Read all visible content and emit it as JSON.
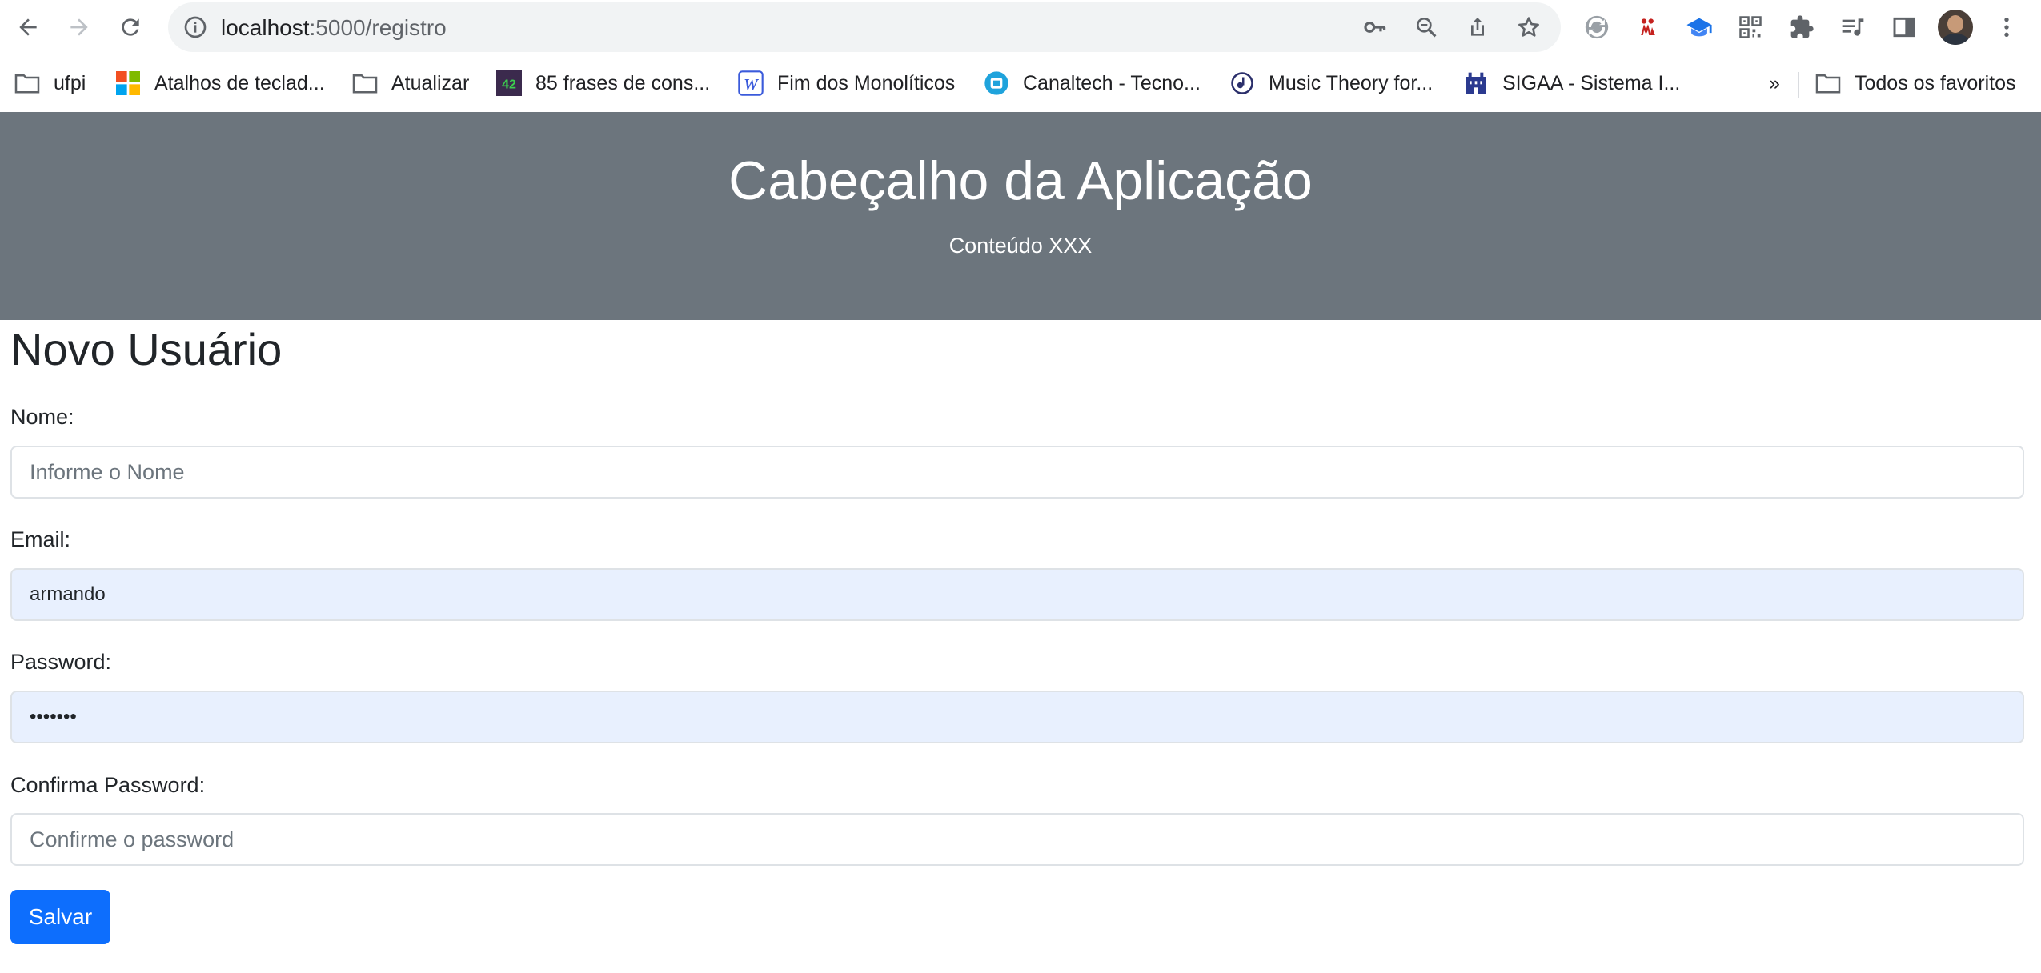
{
  "browser": {
    "url_host": "localhost",
    "url_path": ":5000/registro",
    "bookmarks": [
      {
        "label": "ufpi",
        "icon": "folder-icon"
      },
      {
        "label": "Atalhos de teclad...",
        "icon": "microsoft-logo-icon"
      },
      {
        "label": "Atualizar",
        "icon": "folder-icon"
      },
      {
        "label": "85 frases de cons...",
        "icon": "badge-42-icon",
        "badge": "42"
      },
      {
        "label": "Fim dos Monolíticos",
        "icon": "w-logo-icon",
        "badge": "W"
      },
      {
        "label": "Canaltech - Tecno...",
        "icon": "canaltech-icon"
      },
      {
        "label": "Music Theory for...",
        "icon": "music-theory-icon"
      },
      {
        "label": "SIGAA - Sistema I...",
        "icon": "sigaa-icon"
      }
    ],
    "overflow_label": "»",
    "all_bookmarks_label": "Todos os favoritos"
  },
  "header": {
    "title": "Cabeçalho da Aplicação",
    "subtitle": "Conteúdo XXX",
    "background": "#6c757d"
  },
  "form": {
    "title": "Novo Usuário",
    "nome_label": "Nome:",
    "nome_placeholder": "Informe o Nome",
    "nome_value": "",
    "email_label": "Email:",
    "email_value": "armando",
    "password_label": "Password:",
    "password_value": "•••••••",
    "confirm_label": "Confirma Password:",
    "confirm_placeholder": "Confirme o password",
    "confirm_value": "",
    "submit_label": "Salvar",
    "submit_color": "#0d6efd",
    "autofill_color": "#e8f0fe"
  }
}
